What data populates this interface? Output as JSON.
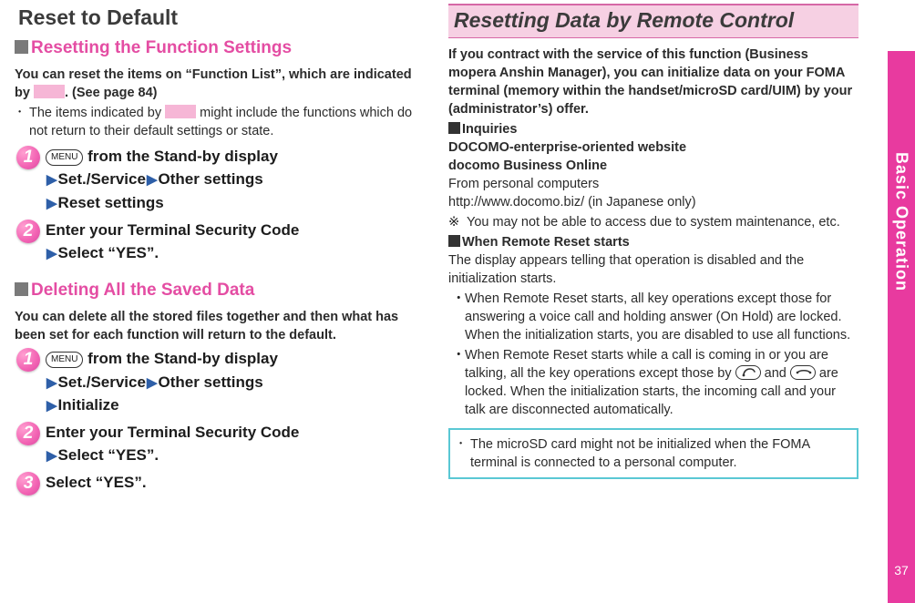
{
  "page_number": "37",
  "side_tab": "Basic Operation",
  "left": {
    "title": "Reset to Default",
    "sub1": "Resetting the Function Settings",
    "reset_intro": "You can reset the items on “Function List”, which are indicated by ",
    "reset_intro2": ". (See page 84)",
    "bullet1_a": "The items indicated by ",
    "bullet1_b": " might include the functions which do not return to their default settings or state.",
    "menu_key": "MENU",
    "step1_lead": " from the Stand-by display",
    "step1_b": "Set./Service",
    "step1_c": "Other settings",
    "step1_d": "Reset settings",
    "step2_a": "Enter your Terminal Security Code",
    "step2_b": "Select “YES”.",
    "sub2": "Deleting All the Saved Data",
    "del_intro": "You can delete all the stored files together and then what has been set for each function will return to the default.",
    "d_step1_lead": " from the Stand-by display",
    "d_step1_b": "Set./Service",
    "d_step1_c": "Other settings",
    "d_step1_d": "Initialize",
    "d_step2_a": "Enter your Terminal Security Code",
    "d_step2_b": "Select “YES”.",
    "d_step3": "Select “YES”."
  },
  "right": {
    "title": "Resetting Data by Remote Control",
    "p1": "If you contract with the service of this function (Business mopera Anshin Manager), you can initialize data on your FOMA terminal (memory within the handset/microSD card/UIM) by your (administrator’s) offer.",
    "inq_hdr": "Inquiries",
    "inq_l1": "DOCOMO-enterprise-oriented website",
    "inq_l2": "docomo Business Online",
    "inq_l3": "From personal computers",
    "inq_l4": "http://www.docomo.biz/ (in Japanese only)",
    "inq_note": "You may not be able to access due to system maintenance, etc.",
    "rr_hdr": "When Remote Reset starts",
    "rr_p": "The display appears telling that operation is disabled and the initialization starts.",
    "rr_b1a": "When Remote Reset starts, all key operations except those for answering a voice call and holding answer (On Hold) are locked.",
    "rr_b1b": "When the initialization starts, you are disabled to use all functions.",
    "rr_b2a": "When Remote Reset starts while a call is coming in or you are talking, all the key operations except those by ",
    "rr_b2b": " and ",
    "rr_b2c": " are locked. When the initialization starts, the incoming call and your talk are disconnected automatically.",
    "note": "The microSD card might not be initialized when the FOMA terminal is connected to a personal computer."
  }
}
